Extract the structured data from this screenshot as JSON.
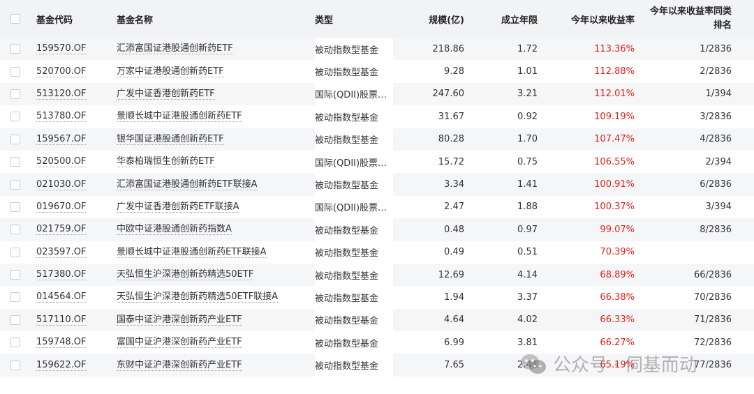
{
  "header": {
    "code": "基金代码",
    "name": "基金名称",
    "type": "类型",
    "size": "规模(亿)",
    "years": "成立年限",
    "return_ytd": "今年以来收益率",
    "rank": "今年以来收益率同类\n排名"
  },
  "rows": [
    {
      "code": "159570.OF",
      "name": "汇添富国证港股通创新药ETF",
      "type": "被动指数型基金",
      "size": "218.86",
      "years": "1.72",
      "ret": "113.36%",
      "rank": "1/2836"
    },
    {
      "code": "520700.OF",
      "name": "万家中证港股通创新药ETF",
      "type": "被动指数型基金",
      "size": "9.28",
      "years": "1.01",
      "ret": "112.88%",
      "rank": "2/2836"
    },
    {
      "code": "513120.OF",
      "name": "广发中证香港创新药ETF",
      "type": "国际(QDII)股票…",
      "size": "247.60",
      "years": "3.21",
      "ret": "112.01%",
      "rank": "1/394"
    },
    {
      "code": "513780.OF",
      "name": "景顺长城中证港股通创新药ETF",
      "type": "被动指数型基金",
      "size": "31.67",
      "years": "0.92",
      "ret": "109.19%",
      "rank": "3/2836"
    },
    {
      "code": "159567.OF",
      "name": "银华国证港股通创新药ETF",
      "type": "被动指数型基金",
      "size": "80.28",
      "years": "1.70",
      "ret": "107.47%",
      "rank": "4/2836"
    },
    {
      "code": "520500.OF",
      "name": "华泰柏瑞恒生创新药ETF",
      "type": "国际(QDII)股票…",
      "size": "15.72",
      "years": "0.75",
      "ret": "106.55%",
      "rank": "2/394"
    },
    {
      "code": "021030.OF",
      "name": "汇添富国证港股通创新药ETF联接A",
      "type": "被动指数型基金",
      "size": "3.34",
      "years": "1.41",
      "ret": "100.91%",
      "rank": "6/2836"
    },
    {
      "code": "019670.OF",
      "name": "广发中证香港创新药ETF联接A",
      "type": "国际(QDII)股票…",
      "size": "2.47",
      "years": "1.88",
      "ret": "100.37%",
      "rank": "3/394"
    },
    {
      "code": "021759.OF",
      "name": "中欧中证港股通创新药指数A",
      "type": "被动指数型基金",
      "size": "0.48",
      "years": "0.97",
      "ret": "99.07%",
      "rank": "8/2836"
    },
    {
      "code": "023597.OF",
      "name": "景顺长城中证港股通创新药ETF联接A",
      "type": "被动指数型基金",
      "size": "0.49",
      "years": "0.51",
      "ret": "70.39%",
      "rank": ""
    },
    {
      "code": "517380.OF",
      "name": "天弘恒生沪深港创新药精选50ETF",
      "type": "被动指数型基金",
      "size": "12.69",
      "years": "4.14",
      "ret": "68.89%",
      "rank": "66/2836"
    },
    {
      "code": "014564.OF",
      "name": "天弘恒生沪深港创新药精选50ETF联接A",
      "type": "被动指数型基金",
      "size": "1.94",
      "years": "3.37",
      "ret": "66.38%",
      "rank": "70/2836"
    },
    {
      "code": "517110.OF",
      "name": "国泰中证沪港深创新药产业ETF",
      "type": "被动指数型基金",
      "size": "4.64",
      "years": "4.02",
      "ret": "66.33%",
      "rank": "71/2836"
    },
    {
      "code": "159748.OF",
      "name": "富国中证沪港深创新药产业ETF",
      "type": "被动指数型基金",
      "size": "6.99",
      "years": "3.81",
      "ret": "66.27%",
      "rank": "72/2836"
    },
    {
      "code": "159622.OF",
      "name": "东财中证沪港深创新药产业ETF",
      "type": "被动指数型基金",
      "size": "7.65",
      "years": "2.41",
      "ret": "65.19%",
      "rank": "77/2836"
    }
  ],
  "watermark": {
    "text": "公众号 · 伺基而动",
    "icon": "wechat-icon"
  },
  "colors": {
    "return_red": "#e2231a",
    "header_bg": "#f2f3f5",
    "stripe_bg": "#f5f6f8"
  }
}
